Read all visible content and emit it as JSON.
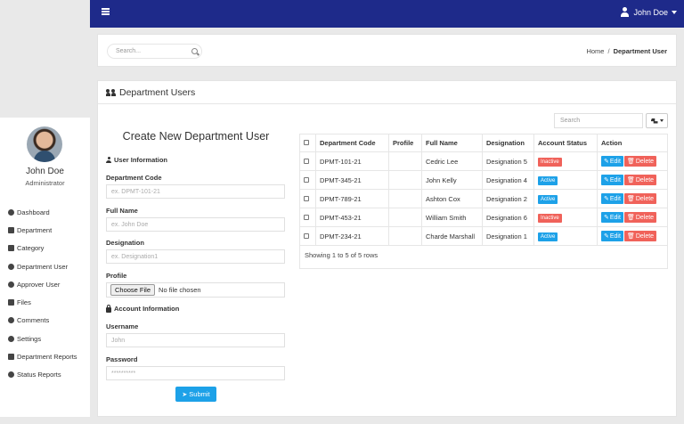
{
  "header": {
    "user_name": "John Doe"
  },
  "sidebar": {
    "profile_name": "John Doe",
    "profile_role": "Administrator",
    "items": [
      {
        "label": "Dashboard",
        "icon": "dashboard-icon"
      },
      {
        "label": "Department",
        "icon": "building-icon"
      },
      {
        "label": "Category",
        "icon": "category-icon"
      },
      {
        "label": "Department User",
        "icon": "users-icon"
      },
      {
        "label": "Approver User",
        "icon": "user-icon"
      },
      {
        "label": "Files",
        "icon": "folder-icon"
      },
      {
        "label": "Comments",
        "icon": "comment-icon"
      },
      {
        "label": "Settings",
        "icon": "gear-icon"
      },
      {
        "label": "Department Reports",
        "icon": "bar-chart-icon"
      },
      {
        "label": "Status Reports",
        "icon": "pie-chart-icon"
      }
    ]
  },
  "top_search": {
    "placeholder": "Search..."
  },
  "breadcrumb": {
    "home": "Home",
    "current": "Department User"
  },
  "page": {
    "title": "Department Users"
  },
  "form": {
    "title": "Create New Department User",
    "user_section": "User Information",
    "department_code_label": "Department Code",
    "department_code_placeholder": "ex. DPMT-101-21",
    "full_name_label": "Full Name",
    "full_name_placeholder": "ex. John Doe",
    "designation_label": "Designation",
    "designation_placeholder": "ex. Designation1",
    "profile_label": "Profile",
    "choose_file": "Choose File",
    "no_file": "No file chosen",
    "account_section": "Account Information",
    "username_label": "Username",
    "username_placeholder": "John",
    "password_label": "Password",
    "password_placeholder": "**********",
    "submit": "Submit"
  },
  "table": {
    "search_placeholder": "Search",
    "columns": [
      "Department Code",
      "Profile",
      "Full Name",
      "Designation",
      "Account Status",
      "Action"
    ],
    "rows": [
      {
        "code": "DPMT-101-21",
        "profile": "",
        "name": "Cedric Lee",
        "designation": "Designation 5",
        "status": "Inactive"
      },
      {
        "code": "DPMT-345-21",
        "profile": "",
        "name": "John Kelly",
        "designation": "Designation 4",
        "status": "Active"
      },
      {
        "code": "DPMT-789-21",
        "profile": "",
        "name": "Ashton Cox",
        "designation": "Designation 2",
        "status": "Active"
      },
      {
        "code": "DPMT-453-21",
        "profile": "",
        "name": "William Smith",
        "designation": "Designation 6",
        "status": "Inactive"
      },
      {
        "code": "DPMT-234-21",
        "profile": "",
        "name": "Charde Marshall",
        "designation": "Designation 1",
        "status": "Active"
      }
    ],
    "edit_label": "Edit",
    "delete_label": "Delete",
    "showing": "Showing 1 to 5 of 5 rows"
  },
  "colors": {
    "navbar": "#1e2a8a",
    "primary": "#1da1e8",
    "danger": "#f0625a"
  }
}
